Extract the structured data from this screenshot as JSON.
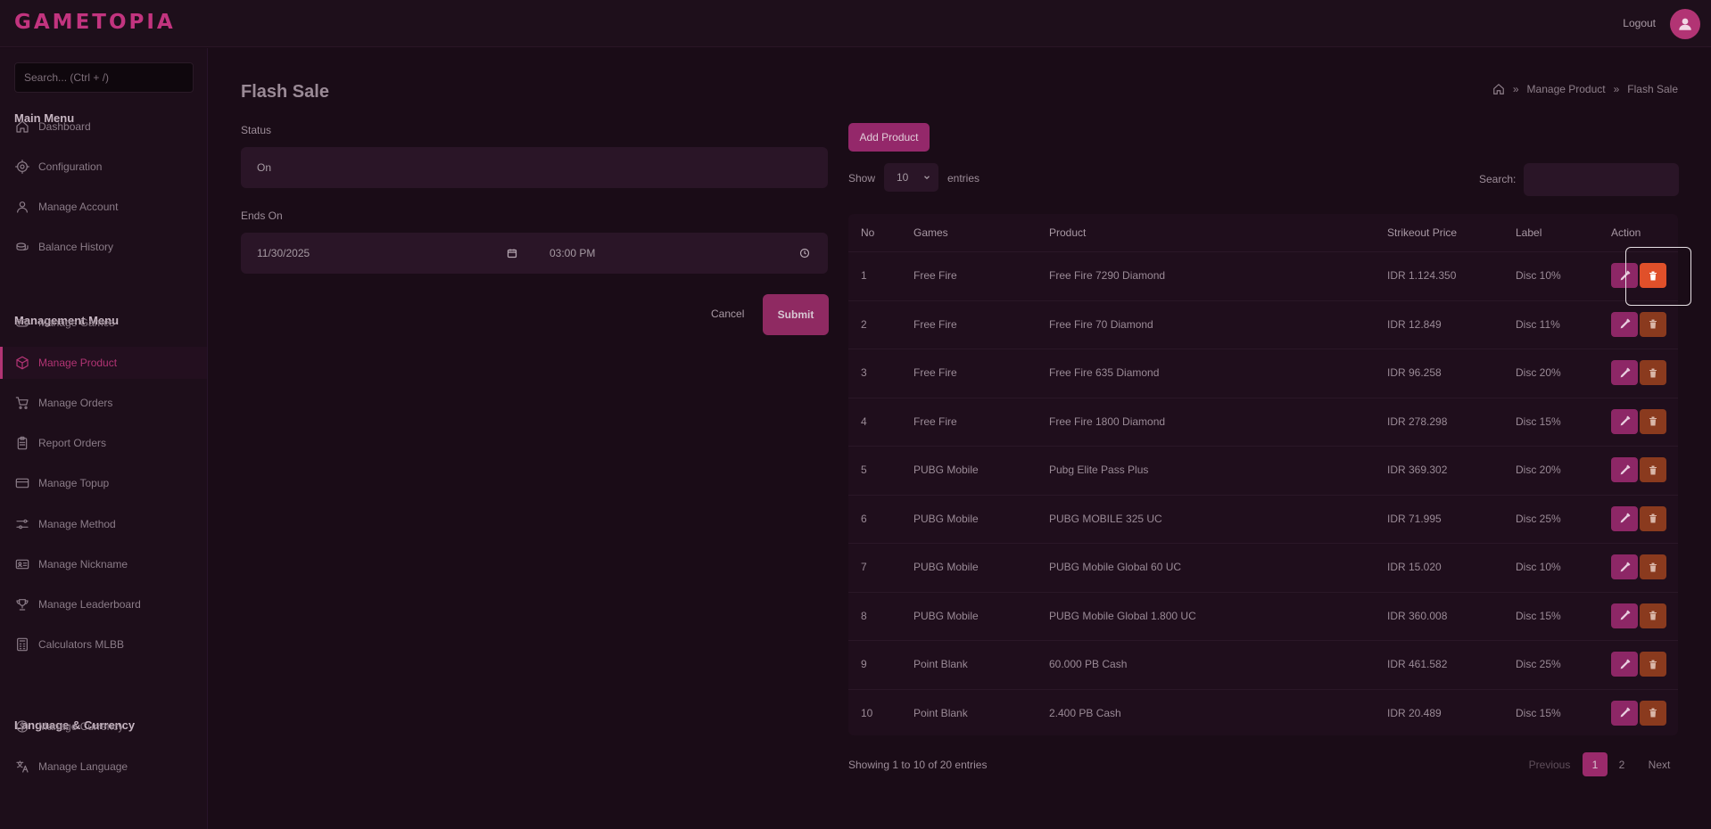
{
  "app": {
    "logo": "GAMETOPIA",
    "logout": "Logout"
  },
  "sidebar": {
    "search_placeholder": "Search... (Ctrl + /)",
    "sections": [
      {
        "heading": "Main Menu",
        "items": [
          {
            "label": "Dashboard",
            "icon": "home-icon"
          },
          {
            "label": "Configuration",
            "icon": "gear-icon"
          },
          {
            "label": "Manage Account",
            "icon": "user-icon"
          },
          {
            "label": "Balance History",
            "icon": "coins-icon"
          }
        ]
      },
      {
        "heading": "Management Menu",
        "items": [
          {
            "label": "Manage Games",
            "icon": "gamepad-icon"
          },
          {
            "label": "Manage Product",
            "icon": "box-icon",
            "active": true
          },
          {
            "label": "Manage Orders",
            "icon": "cart-icon"
          },
          {
            "label": "Report Orders",
            "icon": "clipboard-icon"
          },
          {
            "label": "Manage Topup",
            "icon": "card-icon"
          },
          {
            "label": "Manage Method",
            "icon": "sliders-icon"
          },
          {
            "label": "Manage Nickname",
            "icon": "id-card-icon"
          },
          {
            "label": "Manage Leaderboard",
            "icon": "trophy-icon"
          },
          {
            "label": "Calculators MLBB",
            "icon": "calculator-icon"
          }
        ]
      },
      {
        "heading": "Language & Currency",
        "items": [
          {
            "label": "Manage Currency",
            "icon": "dollar-icon"
          },
          {
            "label": "Manage Language",
            "icon": "translate-icon"
          }
        ]
      }
    ]
  },
  "page": {
    "title": "Flash Sale",
    "breadcrumb": {
      "parent": "Manage Product",
      "current": "Flash Sale",
      "separator": "»"
    }
  },
  "form": {
    "status_label": "Status",
    "status_value": "On",
    "ends_label": "Ends On",
    "date_value": "11/30/2025",
    "time_value": "03:00 PM",
    "cancel": "Cancel",
    "submit": "Submit"
  },
  "table_controls": {
    "add_button": "Add Product",
    "show_label": "Show",
    "show_value": "10",
    "entries_label": "entries",
    "search_label": "Search:"
  },
  "table": {
    "columns": [
      "No",
      "Games",
      "Product",
      "Strikeout Price",
      "Label",
      "Action"
    ],
    "rows": [
      [
        "1",
        "Free Fire",
        "Free Fire 7290 Diamond",
        "IDR 1.124.350",
        "Disc 10%"
      ],
      [
        "2",
        "Free Fire",
        "Free Fire 70 Diamond",
        "IDR 12.849",
        "Disc 11%"
      ],
      [
        "3",
        "Free Fire",
        "Free Fire 635 Diamond",
        "IDR 96.258",
        "Disc 20%"
      ],
      [
        "4",
        "Free Fire",
        "Free Fire 1800 Diamond",
        "IDR 278.298",
        "Disc 15%"
      ],
      [
        "5",
        "PUBG Mobile",
        "Pubg Elite Pass Plus",
        "IDR 369.302",
        "Disc 20%"
      ],
      [
        "6",
        "PUBG Mobile",
        "PUBG MOBILE 325 UC",
        "IDR 71.995",
        "Disc 25%"
      ],
      [
        "7",
        "PUBG Mobile",
        "PUBG Mobile Global 60 UC",
        "IDR 15.020",
        "Disc 10%"
      ],
      [
        "8",
        "PUBG Mobile",
        "PUBG Mobile Global 1.800 UC",
        "IDR 360.008",
        "Disc 15%"
      ],
      [
        "9",
        "Point Blank",
        "60.000 PB Cash",
        "IDR 461.582",
        "Disc 25%"
      ],
      [
        "10",
        "Point Blank",
        "2.400 PB Cash",
        "IDR 20.489",
        "Disc 15%"
      ]
    ]
  },
  "pagination": {
    "info": "Showing 1 to 10 of 20 entries",
    "previous": "Previous",
    "pages": [
      "1",
      "2"
    ],
    "next": "Next"
  },
  "colors": {
    "accent": "#b23474",
    "background": "#1a0c17",
    "delete": "#e0502a"
  }
}
